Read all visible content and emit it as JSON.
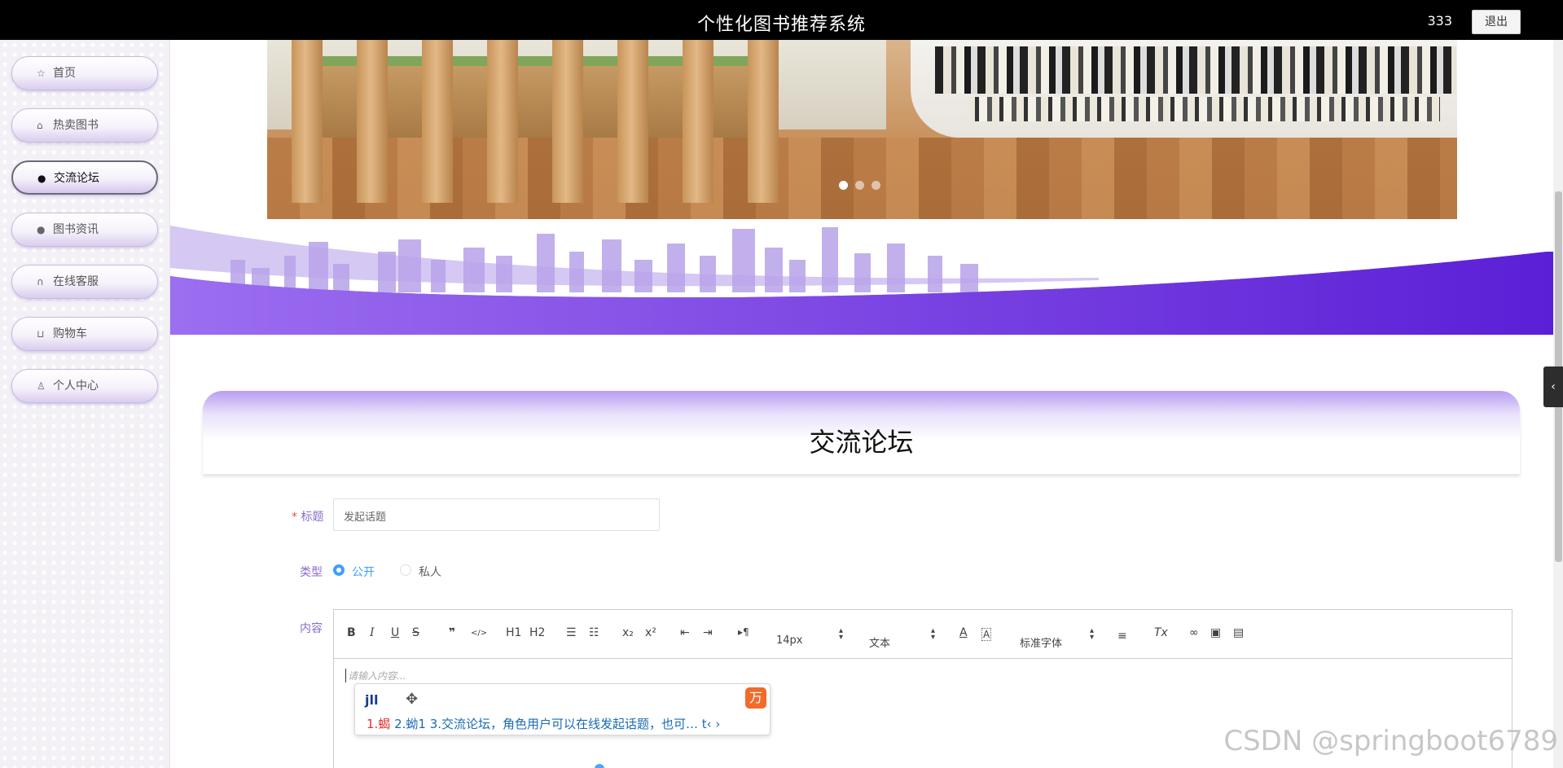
{
  "header": {
    "title": "个性化图书推荐系统",
    "username": "333",
    "logout_label": "退出"
  },
  "sidebar": {
    "items": [
      {
        "label": "首页",
        "icon": "star-icon",
        "active": false
      },
      {
        "label": "热卖图书",
        "icon": "bag-icon",
        "active": false
      },
      {
        "label": "交流论坛",
        "icon": "info-icon",
        "active": true
      },
      {
        "label": "图书资讯",
        "icon": "question-icon",
        "active": false
      },
      {
        "label": "在线客服",
        "icon": "headset-icon",
        "active": false
      },
      {
        "label": "购物车",
        "icon": "cart-icon",
        "active": false
      },
      {
        "label": "个人中心",
        "icon": "user-icon",
        "active": false
      }
    ]
  },
  "carousel": {
    "slide_count": 3,
    "active_slide": 1
  },
  "forum": {
    "heading": "交流论坛",
    "title_label": "标题",
    "title_required_mark": "*",
    "title_placeholder": "发起话题",
    "type_label": "类型",
    "type_options": [
      "公开",
      "私人"
    ],
    "type_selected": "公开",
    "content_label": "内容"
  },
  "editor": {
    "font_size": "14px",
    "block_type": "文本",
    "font_family": "标准字体",
    "placeholder": "请输入内容...",
    "toolbar_icons": [
      "bold-icon",
      "italic-icon",
      "underline-icon",
      "strike-icon",
      "quote-icon",
      "code-icon",
      "h1-icon",
      "h2-icon",
      "ordered-list-icon",
      "bullet-list-icon",
      "subscript-icon",
      "superscript-icon",
      "outdent-icon",
      "indent-icon",
      "direction-icon",
      "font-color-icon",
      "background-color-icon",
      "align-icon",
      "clear-format-icon",
      "link-icon",
      "image-icon",
      "video-icon"
    ],
    "toolbar_text": {
      "bold": "B",
      "italic": "I",
      "underline": "U",
      "strike": "S",
      "quote": "❞",
      "code": "</>",
      "h1": "H1",
      "h2": "H2",
      "sub": "x₂",
      "sup": "x²",
      "direction": "▸¶",
      "clean": "Tx"
    }
  },
  "ime": {
    "typed": "jll",
    "candidates": "1.蝎  2.蚴1  3.交流论坛，角色用户可以在线发起话题，也可…",
    "candidate1": "1.蝎",
    "candidates_rest": "  2.蚴1  3.交流论坛，角色用户可以在线发起话题，也可… t‹ ›",
    "logo_glyph": "万"
  },
  "watermark": "CSDN @springboot6789",
  "colors": {
    "accent": "#8a6cc8",
    "wave": "#7a3fe0",
    "radio": "#409eff"
  }
}
